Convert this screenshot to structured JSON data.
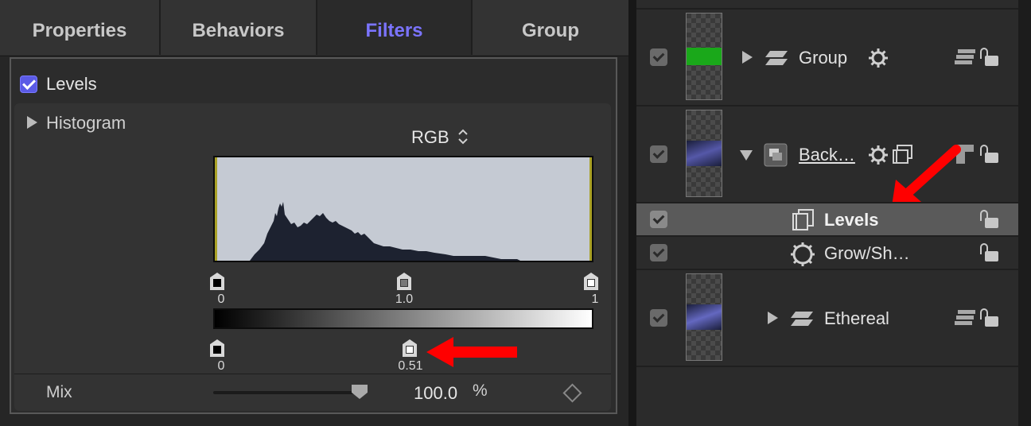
{
  "tabs": [
    {
      "label": "Properties",
      "active": false
    },
    {
      "label": "Behaviors",
      "active": false
    },
    {
      "label": "Filters",
      "active": true
    },
    {
      "label": "Group",
      "active": false
    }
  ],
  "filter": {
    "name": "Levels",
    "enabled": true,
    "histogram_label": "Histogram",
    "channel": "RGB",
    "channel_arrows": "⌃⌄",
    "input_black": "0",
    "input_gamma": "1.0",
    "input_white": "1",
    "output_black": "0",
    "output_white": "0.51",
    "mix_label": "Mix",
    "mix_value": "100.0",
    "mix_unit": "%",
    "mix_level": 1.0
  },
  "layers": [
    {
      "name": "Group",
      "checked": true
    },
    {
      "name": "Back…",
      "checked": true
    },
    {
      "name": "Levels",
      "checked": true,
      "selected": true
    },
    {
      "name": "Grow/Sh…",
      "checked": true
    },
    {
      "name": "Ethereal",
      "checked": true
    }
  ],
  "colors": {
    "accent": "#7b74ff",
    "annotation_arrow": "#ff0000",
    "histogram_bg": "#c5cad3",
    "histogram_fill": "#1d2230",
    "group_thumb": "#1aa81a"
  },
  "icons": [
    "checkbox-icon",
    "disclosure-triangle-icon",
    "gear-icon",
    "stack-icon",
    "lock-icon",
    "filmstrip-icon",
    "gear-outline-icon",
    "diamond-keyframe-icon",
    "layers-icon"
  ]
}
